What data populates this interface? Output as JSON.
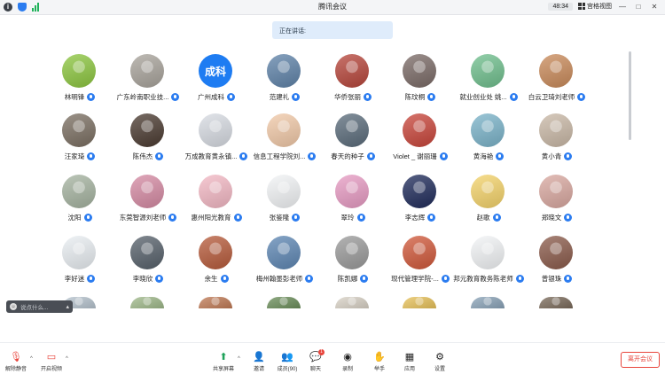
{
  "titlebar": {
    "title": "腾讯会议",
    "timer": "48:34",
    "view_label": "宫格视图",
    "min_glyph": "—",
    "max_glyph": "□",
    "close_glyph": "✕"
  },
  "speaking": {
    "label": "正在讲话:"
  },
  "colors": {
    "accent": "#2b7cf0",
    "leave": "#e8453c",
    "speaking_bg": "#dfecfb"
  },
  "participants": [
    {
      "name": "林明锋",
      "avatar": "frog-avatar",
      "bg": "#8cc63f"
    },
    {
      "name": "广东岭南职业技...",
      "avatar": "photo-avatar",
      "bg": "#a8a39b"
    },
    {
      "name": "广州成科",
      "avatar": "text-avatar",
      "text": "成科",
      "bg": "#1e7cf2"
    },
    {
      "name": "范建礼",
      "avatar": "photo-avatar",
      "bg": "#5e82a8"
    },
    {
      "name": "华侨张丽",
      "avatar": "photo-avatar",
      "bg": "#b6453a"
    },
    {
      "name": "陈玟桐",
      "avatar": "photo-avatar",
      "bg": "#7a6a66"
    },
    {
      "name": "就业创业处 姚...",
      "avatar": "opera-avatar",
      "bg": "#6fbf8d"
    },
    {
      "name": "白云卫琦刘老师",
      "avatar": "photo-avatar",
      "bg": "#c98a5a"
    },
    {
      "name": "汪家琦",
      "avatar": "photo-avatar",
      "bg": "#7a6e61"
    },
    {
      "name": "陈伟杰",
      "avatar": "photo-avatar",
      "bg": "#4a3a30"
    },
    {
      "name": "万成教育黄永镇...",
      "avatar": "logo-avatar",
      "bg": "#d7dbe2"
    },
    {
      "name": "信息工程学院刘...",
      "avatar": "cartoon-avatar",
      "bg": "#f1c9a8"
    },
    {
      "name": "春天的种子",
      "avatar": "photo-avatar",
      "bg": "#5a6b7a"
    },
    {
      "name": "Violet _ 谢丽珊",
      "avatar": "photo-avatar",
      "bg": "#c8453a"
    },
    {
      "name": "黄海艳",
      "avatar": "photo-avatar",
      "bg": "#7ab3c9"
    },
    {
      "name": "黄小青",
      "avatar": "photo-avatar",
      "bg": "#c9b8a6"
    },
    {
      "name": "沈阳",
      "avatar": "photo-avatar",
      "bg": "#a5b3a0"
    },
    {
      "name": "东莞智源刘老师",
      "avatar": "photo-avatar",
      "bg": "#d58aa3"
    },
    {
      "name": "惠州阳光教育",
      "avatar": "cartoon-avatar",
      "bg": "#f3b8c4"
    },
    {
      "name": "张鉴隆",
      "avatar": "logo-avatar",
      "bg": "#f2f4f6"
    },
    {
      "name": "翠玲",
      "avatar": "photo-avatar",
      "bg": "#e79bc3"
    },
    {
      "name": "李志辉",
      "avatar": "photo-avatar",
      "bg": "#1f2b5a"
    },
    {
      "name": "赵歌",
      "avatar": "cartoon-avatar",
      "bg": "#f4d36a"
    },
    {
      "name": "郑晓文",
      "avatar": "photo-avatar",
      "bg": "#d9a8a0"
    },
    {
      "name": "李好迷",
      "avatar": "cartoon-avatar",
      "bg": "#e9eef2"
    },
    {
      "name": "李晓欣",
      "avatar": "photo-avatar",
      "bg": "#56606a"
    },
    {
      "name": "余生",
      "avatar": "photo-avatar",
      "bg": "#b65a3a"
    },
    {
      "name": "梅州翰墨彭老师",
      "avatar": "photo-avatar",
      "bg": "#5d86b3"
    },
    {
      "name": "陈凯娜",
      "avatar": "photo-avatar",
      "bg": "#9a9a9a"
    },
    {
      "name": "现代管理学院-...",
      "avatar": "photo-avatar",
      "bg": "#d0583a"
    },
    {
      "name": "邦元教育教务陈老师",
      "avatar": "logo-avatar",
      "bg": "#f2f4f6"
    },
    {
      "name": "曾银珠",
      "avatar": "photo-avatar",
      "bg": "#8a5a4a"
    },
    {
      "avatar": "photo-avatar",
      "bg": "#b7c4cf"
    },
    {
      "avatar": "photo-avatar",
      "bg": "#9fb98a"
    },
    {
      "avatar": "photo-avatar",
      "bg": "#c07a55"
    },
    {
      "avatar": "photo-avatar",
      "bg": "#6b8e5a"
    },
    {
      "avatar": "photo-avatar",
      "bg": "#d9d2c6"
    },
    {
      "avatar": "photo-avatar",
      "bg": "#e8c25a"
    },
    {
      "avatar": "photo-avatar",
      "bg": "#8aa3b8"
    },
    {
      "avatar": "photo-avatar",
      "bg": "#7a6a5a"
    }
  ],
  "chat": {
    "placeholder": "说点什么..."
  },
  "toolbar": {
    "unmute": "解除静音",
    "start_video": "开启视频",
    "share_screen": "共享屏幕",
    "invite": "邀请",
    "members": "成员(90)",
    "chat": "聊天",
    "chat_badge": "1",
    "record": "录制",
    "raise_hand": "举手",
    "apps": "应用",
    "settings": "设置",
    "leave": "离开会议"
  }
}
